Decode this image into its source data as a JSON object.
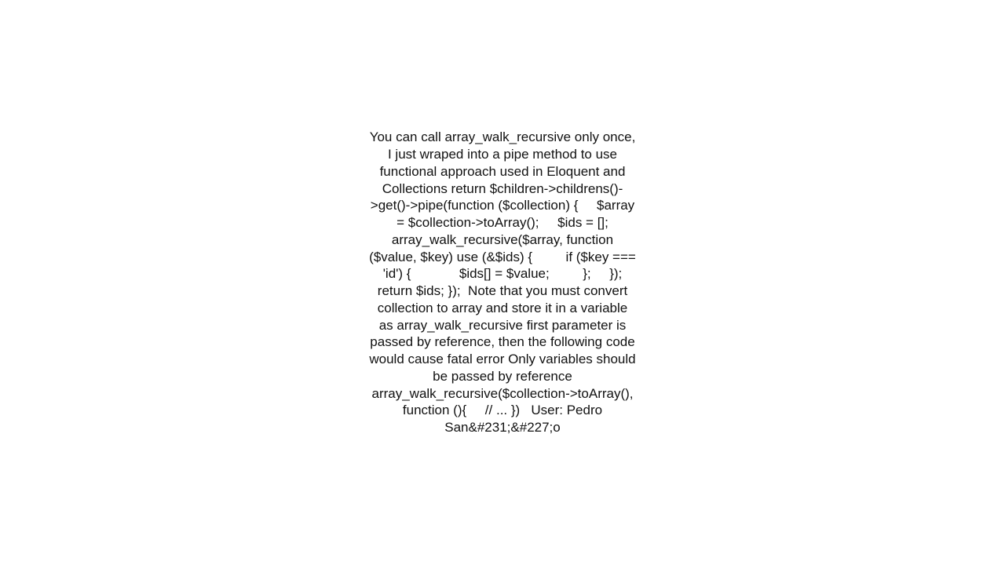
{
  "content": {
    "text": "You can call array_walk_recursive only once, I just wraped into a pipe method to use functional approach used in Eloquent and Collections return $children->childrens()->get()->pipe(function ($collection) {     $array = $collection->toArray();     $ids = [];     array_walk_recursive($array, function ($value, $key) use (&$ids) {         if ($key === 'id') {             $ids[] = $value;         };     });     return $ids; });  Note that you must convert collection to array and store it in a variable as array_walk_recursive first parameter is passed by reference, then the following code would cause fatal error Only variables should be passed by reference array_walk_recursive($collection->toArray(), function (){     // ... })   User: Pedro San&#231;&#227;o"
  }
}
